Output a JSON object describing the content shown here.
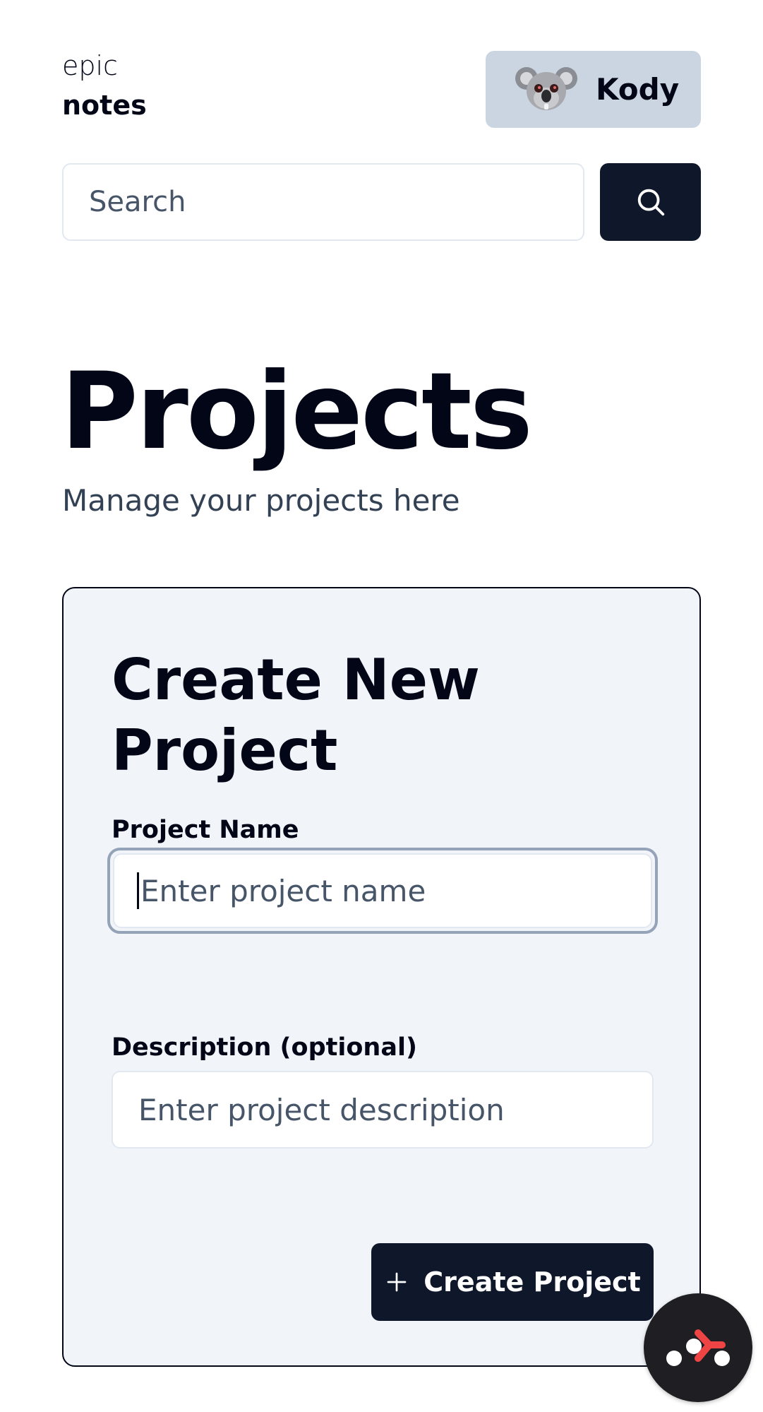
{
  "header": {
    "logo_light": "epic",
    "logo_bold": "notes",
    "user_name": "Kody",
    "avatar_icon": "koala-avatar"
  },
  "search": {
    "placeholder": "Search",
    "value": "",
    "button_icon": "search-icon"
  },
  "page": {
    "title": "Projects",
    "subtitle": "Manage your projects here"
  },
  "create_form": {
    "title": "Create New Project",
    "name_label": "Project Name",
    "name_placeholder": "Enter project name",
    "name_value": "",
    "description_label": "Description (optional)",
    "description_placeholder": "Enter project description",
    "description_value": "",
    "submit_label": "Create Project",
    "submit_icon": "plus-icon"
  },
  "fab": {
    "icon": "connections-icon"
  },
  "colors": {
    "primary": "#0f172a",
    "text": "#020617",
    "muted": "#475569",
    "card_bg": "#f1f5f9",
    "user_btn_bg": "#cbd5e1",
    "fab_accent": "#ef4444"
  }
}
